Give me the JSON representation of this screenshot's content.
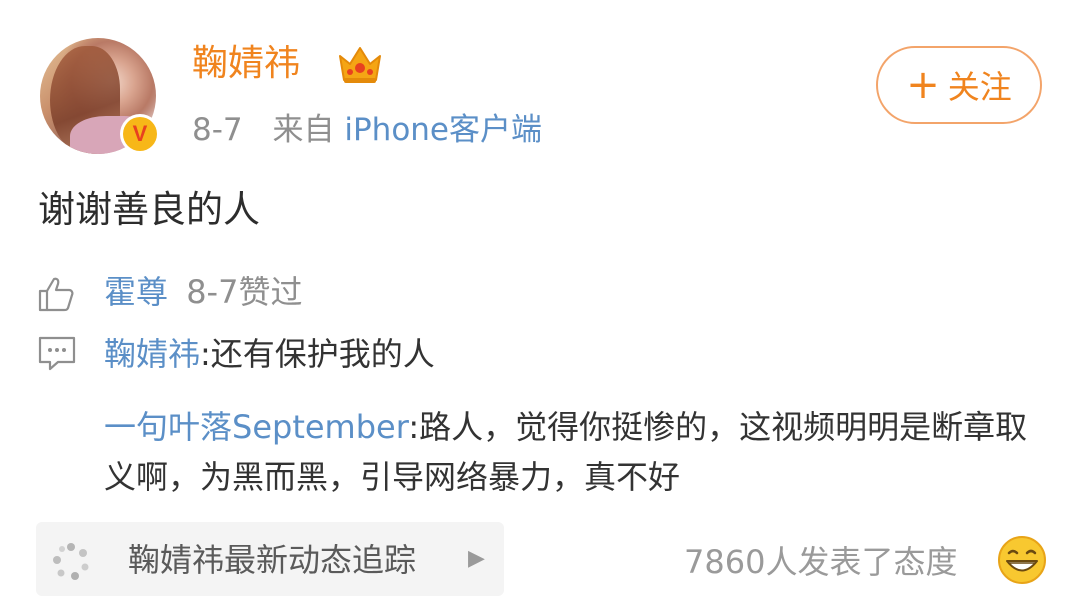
{
  "post": {
    "username": "鞠婧祎",
    "date": "8-7",
    "source_prefix": "来自",
    "source": "iPhone客户端",
    "follow_label": "关注",
    "content": "谢谢善良的人"
  },
  "likes": {
    "user": "霍尊",
    "text": "8-7赞过"
  },
  "comments": [
    {
      "user": "鞠婧祎",
      "text": ":还有保护我的人"
    },
    {
      "user": "一句叶落September",
      "text": ":路人，觉得你挺惨的，这视频明明是断章取义啊，为黑而黑，引导网络暴力，真不好"
    }
  ],
  "footer": {
    "tracker_label": "鞠婧祎最新动态追踪",
    "attitude_text": "7860人发表了态度"
  },
  "icons": {
    "verified": "verified-v-icon",
    "crown": "crown-icon",
    "like": "thumbs-up-icon",
    "comment": "comment-icon",
    "spark": "sparkle-icon",
    "arrow": "play-arrow-icon",
    "emoji": "grin-emoji-icon"
  },
  "colors": {
    "username": "#f0841e",
    "link": "#5b8fc7",
    "meta": "#8f8f8f",
    "follow_border": "#f3a46a",
    "verified_bg": "#f7b718"
  }
}
